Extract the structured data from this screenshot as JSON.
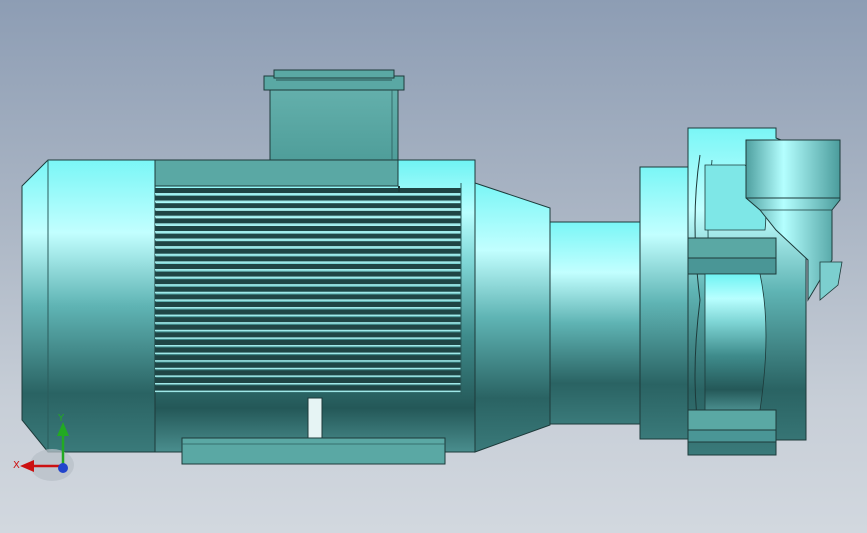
{
  "viewport": {
    "background_top": "#8d9db4",
    "background_bottom": "#d2d8df"
  },
  "model": {
    "body_color": "#5aa8a4",
    "highlight_color": "#b8ffff",
    "edge_color": "#1d3a3a"
  },
  "triad": {
    "x_label": "X",
    "y_label": "Y",
    "x_color": "#cc1111",
    "y_color": "#22aa22",
    "z_color": "#2244cc"
  }
}
